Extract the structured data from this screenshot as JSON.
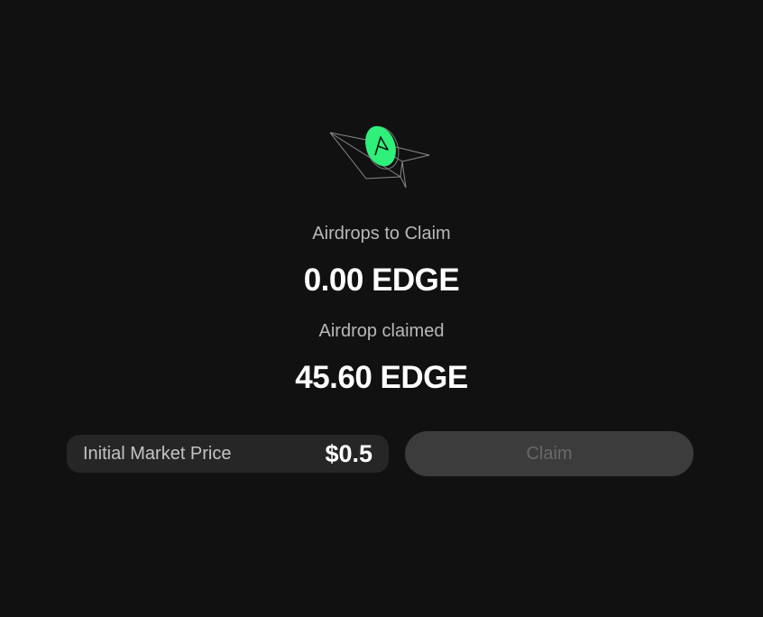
{
  "colors": {
    "background": "#111111",
    "accent": "#2ef07a",
    "panel": "#262626",
    "button_disabled": "#3c3c3c"
  },
  "logo": {
    "icon": "paper-plane-coin-icon"
  },
  "to_claim": {
    "label": "Airdrops to Claim",
    "amount": "0.00 EDGE"
  },
  "claimed": {
    "label": "Airdrop claimed",
    "amount": "45.60 EDGE"
  },
  "market_price": {
    "label": "Initial Market Price",
    "value": "$0.5"
  },
  "claim_button": {
    "label": "Claim",
    "state": "disabled"
  }
}
